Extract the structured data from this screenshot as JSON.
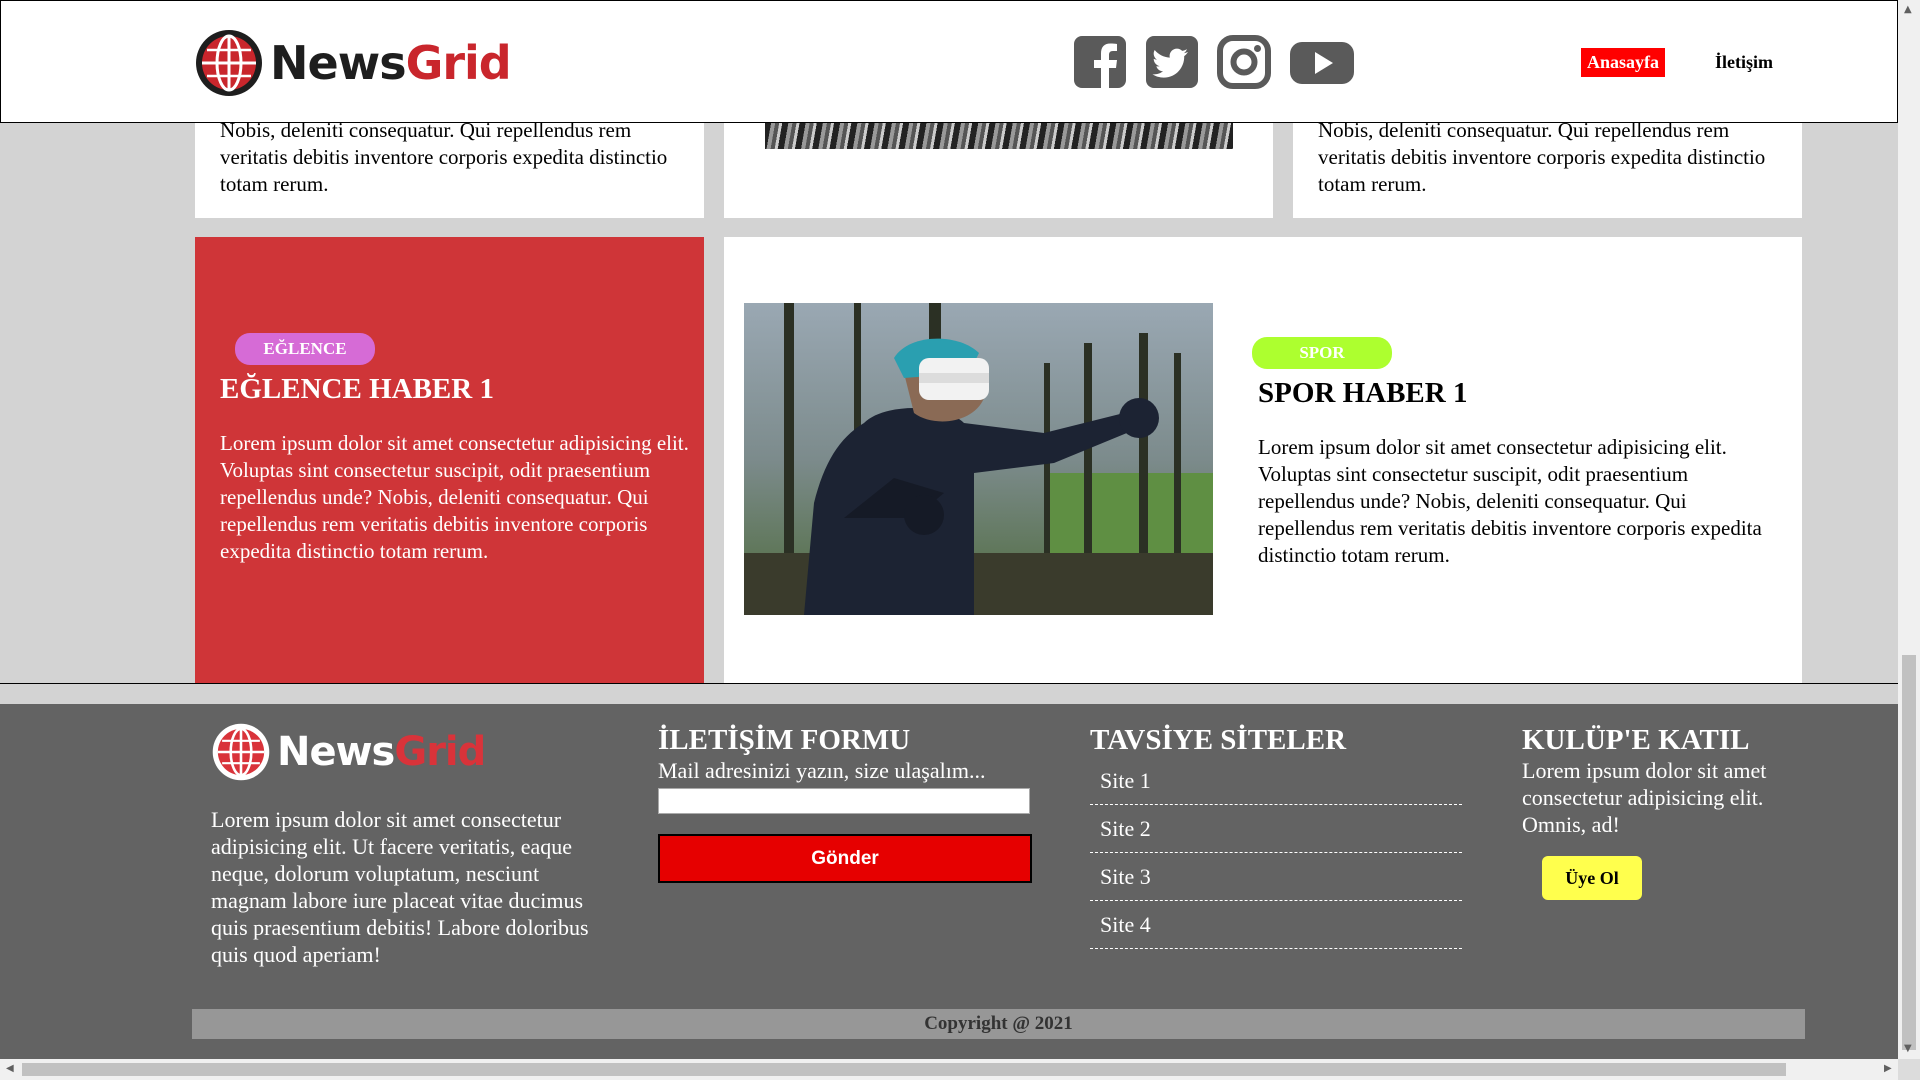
{
  "header": {
    "logo": {
      "part1": "News",
      "part2": "Grid"
    },
    "social_icons": [
      "facebook-icon",
      "twitter-icon",
      "instagram-icon",
      "youtube-icon"
    ],
    "nav": {
      "home": "Anasayfa",
      "contact": "İletişim"
    }
  },
  "top_row": {
    "left_text": "Nobis, deleniti consequatur. Qui repellendus rem veritatis debitis inventore corporis expedita distinctio totam rerum.",
    "right_text": "Nobis, deleniti consequatur. Qui repellendus rem veritatis debitis inventore corporis expedita distinctio totam rerum."
  },
  "entertainment": {
    "badge": "EĞLENCE",
    "title": "EĞLENCE HABER 1",
    "text": "Lorem ipsum dolor sit amet consectetur adipisicing elit. Voluptas sint consectetur suscipit, odit praesentium repellendus unde? Nobis, deleniti consequatur. Qui repellendus rem veritatis debitis inventore corporis expedita distinctio totam rerum."
  },
  "sport": {
    "badge": "SPOR",
    "title": "SPOR HABER 1",
    "text": "Lorem ipsum dolor sit amet consectetur adipisicing elit. Voluptas sint consectetur suscipit, odit praesentium repellendus unde? Nobis, deleniti consequatur. Qui repellendus rem veritatis debitis inventore corporis expedita distinctio totam rerum."
  },
  "footer": {
    "logo": {
      "part1": "News",
      "part2": "Grid"
    },
    "about": "Lorem ipsum dolor sit amet consectetur adipisicing elit. Ut facere veritatis, eaque neque, dolorum voluptatum, nesciunt magnam labore iure placeat vitae ducimus quis praesentium debitis! Labore doloribus quis quod aperiam!",
    "form": {
      "title": "İLETİŞİM FORMU",
      "subtitle": "Mail adresinizi yazın, size ulaşalım...",
      "input_value": "",
      "button": "Gönder"
    },
    "sites": {
      "title": "TAVSİYE SİTELER",
      "items": [
        "Site 1",
        "Site 2",
        "Site 3",
        "Site 4"
      ]
    },
    "club": {
      "title": "KULÜP'E KATIL",
      "text": "Lorem ipsum dolor sit amet consectetur adipisicing elit. Omnis, ad!",
      "button": "Üye Ol"
    },
    "copyright": "Copyright @ 2021"
  },
  "colors": {
    "brand_red": "#c9262c",
    "nav_active": "#ff0000",
    "ent_card": "#cf3538",
    "ent_badge": "#d66bd6",
    "sport_badge": "#adff2f",
    "footer_bg": "#636363",
    "submit_btn": "#e60000",
    "join_btn": "#ffff4d"
  }
}
